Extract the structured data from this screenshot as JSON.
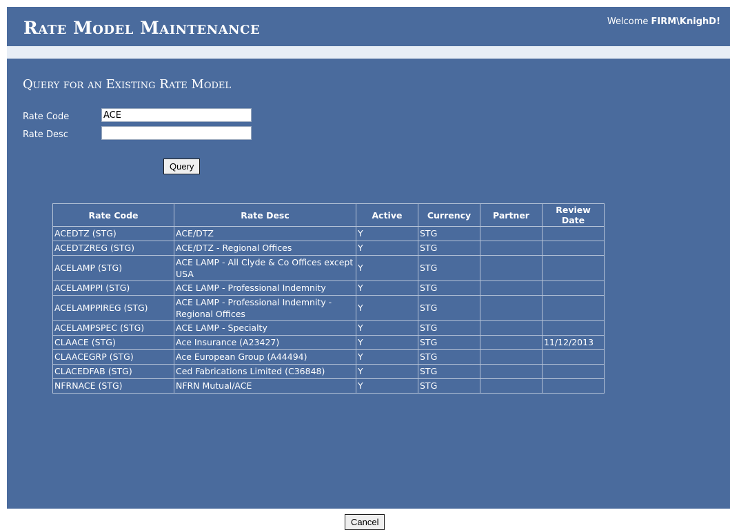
{
  "app": {
    "title": "Rate Model Maintenance",
    "welcome_prefix": "Welcome ",
    "user": "FIRM\\KnighD!"
  },
  "query": {
    "section_title": "Query for an Existing Rate Model",
    "rate_code_label": "Rate Code",
    "rate_code_value": "ACE",
    "rate_desc_label": "Rate Desc",
    "rate_desc_value": "",
    "query_button": "Query"
  },
  "results": {
    "columns": [
      "Rate Code",
      "Rate Desc",
      "Active",
      "Currency",
      "Partner",
      "Review Date"
    ],
    "rows": [
      {
        "code": "ACEDTZ (STG)",
        "desc": "ACE/DTZ",
        "active": "Y",
        "currency": "STG",
        "partner": "",
        "review": ""
      },
      {
        "code": "ACEDTZREG (STG)",
        "desc": "ACE/DTZ - Regional Offices",
        "active": "Y",
        "currency": "STG",
        "partner": "",
        "review": ""
      },
      {
        "code": "ACELAMP (STG)",
        "desc": "ACE LAMP - All Clyde & Co Offices except USA",
        "active": "Y",
        "currency": "STG",
        "partner": "",
        "review": ""
      },
      {
        "code": "ACELAMPPI (STG)",
        "desc": "ACE LAMP - Professional Indemnity",
        "active": "Y",
        "currency": "STG",
        "partner": "",
        "review": ""
      },
      {
        "code": "ACELAMPPIREG (STG)",
        "desc": "ACE LAMP - Professional Indemnity - Regional Offices",
        "active": "Y",
        "currency": "STG",
        "partner": "",
        "review": ""
      },
      {
        "code": "ACELAMPSPEC (STG)",
        "desc": "ACE LAMP - Specialty",
        "active": "Y",
        "currency": "STG",
        "partner": "",
        "review": ""
      },
      {
        "code": "CLAACE (STG)",
        "desc": "Ace Insurance (A23427)",
        "active": "Y",
        "currency": "STG",
        "partner": "",
        "review": "11/12/2013"
      },
      {
        "code": "CLAACEGRP (STG)",
        "desc": "Ace European Group (A44494)",
        "active": "Y",
        "currency": "STG",
        "partner": "",
        "review": ""
      },
      {
        "code": "CLACEDFAB (STG)",
        "desc": "Ced Fabrications Limited (C36848)",
        "active": "Y",
        "currency": "STG",
        "partner": "",
        "review": ""
      },
      {
        "code": "NFRNACE (STG)",
        "desc": "NFRN Mutual/ACE",
        "active": "Y",
        "currency": "STG",
        "partner": "",
        "review": ""
      }
    ]
  },
  "footer": {
    "cancel_button": "Cancel"
  }
}
